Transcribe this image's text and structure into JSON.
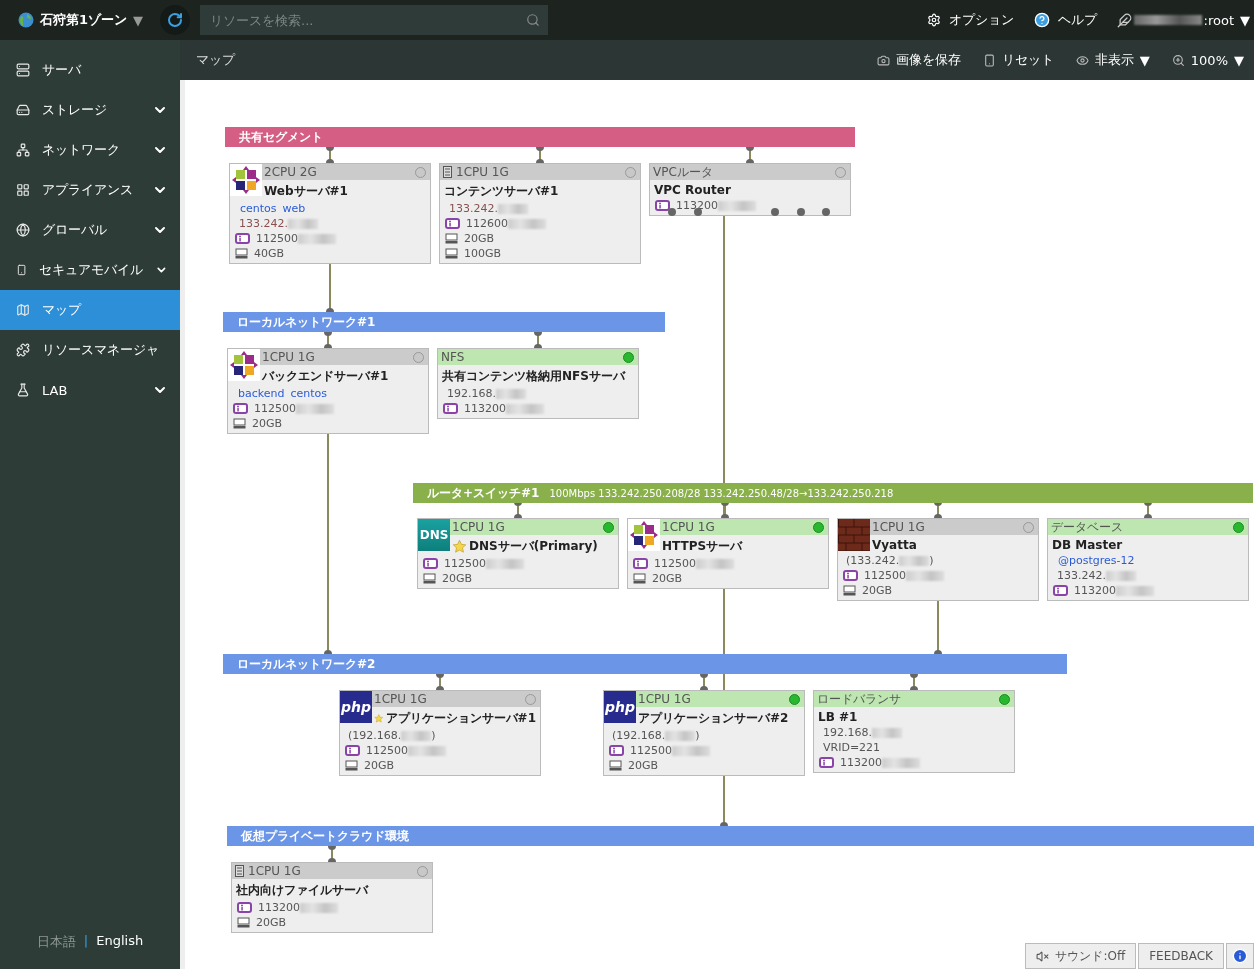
{
  "topbar": {
    "zone": "石狩第1ゾーン",
    "zone_caret": "▼",
    "search": {
      "placeholder": "リソースを検索..."
    },
    "links": [
      {
        "label": "オプション"
      },
      {
        "label": "ヘルプ"
      }
    ],
    "user": ":root",
    "user_caret": "▼"
  },
  "sidebar": {
    "items": [
      {
        "label": "サーバ",
        "expandable": false,
        "selected": false
      },
      {
        "label": "ストレージ",
        "expandable": true,
        "selected": false
      },
      {
        "label": "ネットワーク",
        "expandable": true,
        "selected": false
      },
      {
        "label": "アプライアンス",
        "expandable": true,
        "selected": false
      },
      {
        "label": "グローバル",
        "expandable": true,
        "selected": false
      },
      {
        "label": "セキュアモバイル",
        "expandable": true,
        "selected": false
      },
      {
        "label": "マップ",
        "expandable": false,
        "selected": true
      },
      {
        "label": "リソースマネージャ",
        "expandable": false,
        "selected": false
      },
      {
        "label": "LAB",
        "expandable": true,
        "selected": false
      }
    ],
    "languages": [
      {
        "label": "日本語",
        "selected": false
      },
      {
        "label": "English",
        "selected": true
      }
    ],
    "language_separator": "|"
  },
  "page": {
    "title": "マップ",
    "toolbar": [
      {
        "label": "画像を保存"
      },
      {
        "label": "リセット"
      },
      {
        "label": "非表示",
        "caret": "▼"
      },
      {
        "label": "100%",
        "caret": "▼"
      }
    ]
  },
  "map": {
    "segments": [
      {
        "label": "共有セグメント",
        "color": "#d55f84"
      },
      {
        "label": "ローカルネットワーク#1",
        "color": "#6b96e8"
      },
      {
        "label": "ルータ+スイッチ#1",
        "color": "#8ab04b",
        "info": "100Mbps  133.242.250.208/28  133.242.250.48/28→133.242.250.218"
      },
      {
        "label": "ローカルネットワーク#2",
        "color": "#6b96e8"
      },
      {
        "label": "仮想プライベートクラウド環境",
        "color": "#6b96e8"
      }
    ],
    "nodes": [
      {
        "header": "2CPU 2G",
        "running": false,
        "name": "Webサーバ#1",
        "star": false,
        "tags": [
          "centos",
          "web"
        ],
        "ip": "133.242.",
        "id": "112500",
        "disks": [
          "40GB"
        ]
      },
      {
        "header": "1CPU 1G",
        "running": false,
        "name": "コンテンツサーバ#1",
        "star": false,
        "ip": "133.242.",
        "id": "112600",
        "disks": [
          "20GB",
          "100GB"
        ]
      },
      {
        "header": "VPCルータ",
        "running": false,
        "name": "VPC Router",
        "star": false,
        "id": "113200"
      },
      {
        "header": "1CPU 1G",
        "running": false,
        "name": "バックエンドサーバ#1",
        "star": false,
        "tags": [
          "backend",
          "centos"
        ],
        "id": "112500",
        "disks": [
          "20GB"
        ]
      },
      {
        "header": "NFS",
        "running": true,
        "name": "共有コンテンツ格納用NFSサーバ",
        "star": false,
        "ip": "192.168.",
        "id": "113200"
      },
      {
        "header": "1CPU 1G",
        "running": true,
        "icon_label": "DNS",
        "name": "DNSサーバ(Primary)",
        "star": true,
        "id": "112500",
        "disks": [
          "20GB"
        ]
      },
      {
        "header": "1CPU 1G",
        "running": true,
        "name": "HTTPSサーバ",
        "star": false,
        "id": "112500",
        "disks": [
          "20GB"
        ]
      },
      {
        "header": "1CPU 1G",
        "running": false,
        "name": "Vyatta",
        "star": false,
        "ip": "(133.242.",
        "ip_end": ")",
        "id": "112500",
        "disks": [
          "20GB"
        ]
      },
      {
        "header": "データベース",
        "running": true,
        "name": "DB Master",
        "star": false,
        "tags": [
          "@postgres-12"
        ],
        "ip": "133.242.",
        "id": "113200"
      },
      {
        "header": "1CPU 1G",
        "running": false,
        "icon_label": "php",
        "name": "アプリケーションサーバ#1",
        "star": true,
        "ip": "(192.168.",
        "ip_end": ")",
        "id": "112500",
        "disks": [
          "20GB"
        ]
      },
      {
        "header": "1CPU 1G",
        "running": true,
        "icon_label": "php",
        "name": "アプリケーションサーバ#2",
        "star": false,
        "ip": "(192.168.",
        "ip_end": ")",
        "id": "112500",
        "disks": [
          "20GB"
        ]
      },
      {
        "header": "ロードバランサ",
        "running": true,
        "name": "LB #1",
        "star": false,
        "ip": "192.168.",
        "extra": "VRID=221",
        "id": "113200"
      },
      {
        "header": "1CPU 1G",
        "running": false,
        "name": "社内向けファイルサーバ",
        "star": false,
        "id": "113200",
        "disks": [
          "20GB"
        ]
      }
    ]
  },
  "footer": {
    "sound": "サウンド:Off",
    "feedback": "FEEDBACK"
  }
}
